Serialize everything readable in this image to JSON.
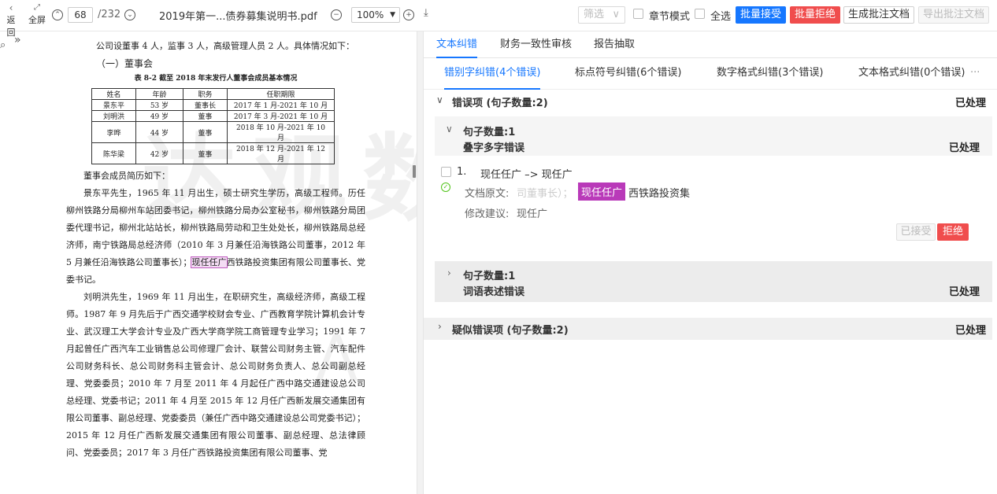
{
  "toolbar": {
    "back_label": "返回",
    "fullscreen_label": "全屏",
    "page_current": "68",
    "page_total": "/232",
    "file_name": "2019年第一...债券募集说明书.pdf",
    "zoom": "100%",
    "filter_placeholder": "筛选",
    "chapter_mode": "章节模式",
    "select_all": "全选",
    "batch_accept": "批量接受",
    "batch_reject": "批量拒绝",
    "gen_doc": "生成批注文档",
    "export_doc": "导出批注文档"
  },
  "document": {
    "line1": "公司设董事 4 人，监事 3 人，高级管理人员 2 人。具体情况如下：",
    "section": "（一）董事会",
    "table_title": "表 8-2  截至 2018 年末发行人董事会成员基本情况",
    "table_headers": [
      "姓名",
      "年龄",
      "职务",
      "任职期限"
    ],
    "table_rows": [
      [
        "景东平",
        "53 岁",
        "董事长",
        "2017 年 1 月-2021 年 10 月"
      ],
      [
        "刘明洪",
        "49 岁",
        "董事",
        "2017 年 3 月-2021 年 10 月"
      ],
      [
        "李晔",
        "44 岁",
        "董事",
        "2018 年 10 月-2021 年 10 月"
      ],
      [
        "陈华梁",
        "42 岁",
        "董事",
        "2018 年 12 月-2021 年 12 月"
      ]
    ],
    "intro": "董事会成员简历如下：",
    "para1_a": "景东平先生，1965 年 11 月出生，硕士研究生学历，高级工程师。历任柳州铁路分局柳州车站团委书记，柳州铁路分局办公室秘书，柳州铁路分局团委代理书记，柳州北站站长，柳州铁路局劳动和卫生处处长，柳州铁路局总经济师，南宁铁路局总经济师（2010 年 3 月兼任沿海铁路公司董事，2012 年 5 月兼任沿海铁路公司董事长）；",
    "para1_hl": "现任任广",
    "para1_b": "西铁路投资集团有限公司董事长、党委书记。",
    "para2": "刘明洪先生，1969 年 11 月出生，在职研究生，高级经济师，高级工程师。1987 年 9 月先后于广西交通学校财会专业、广西教育学院计算机会计专业、武汉理工大学会计专业及广西大学商学院工商管理专业学习；1991 年 7 月起曾任广西汽车工业销售总公司修理厂会计、联营公司财务主管、汽车配件公司财务科长、总公司财务科主管会计、总公司财务负责人、总公司副总经理、党委委员；2010 年 7 月至 2011 年 4 月起任广西中路交通建设总公司总经理、党委书记；2011 年 4 月至 2015 年 12 月任广西新发展交通集团有限公司董事、副总经理、党委委员（兼任广西中路交通建设总公司党委书记）；2015 年 12 月任广西新发展交通集团有限公司董事、副总经理、总法律顾问、党委委员；2017 年 3 月任广西铁路投资集团有限公司董事、党"
  },
  "panel": {
    "tabs": [
      "文本纠错",
      "财务一致性审核",
      "报告抽取"
    ],
    "subtabs": [
      "错别字纠错(4个错误)",
      "标点符号纠错(6个错误)",
      "数字格式纠错(3个错误)",
      "文本格式纠错(0个错误)"
    ],
    "more": "···",
    "errors_header": "错误项 (句子数量:2)",
    "errors_status": "已处理",
    "group1_count": "句子数量:1",
    "group1_type": "叠字多字错误",
    "group1_status": "已处理",
    "item_index": "1.",
    "item_change": "现任任广 –> 现任广",
    "orig_label": "文档原文:",
    "orig_before": "司董事长）；",
    "orig_hl": "现任任广",
    "orig_after": "西铁路投资集",
    "suggest_label": "修改建议:",
    "suggest_value": "现任广",
    "accepted": "已接受",
    "reject": "拒绝",
    "group2_count": "句子数量:1",
    "group2_type": "词语表述错误",
    "group2_status": "已处理",
    "suspect_header": "疑似错误项 (句子数量:2)",
    "suspect_status": "已处理"
  },
  "colors": {
    "accent": "#1677ff",
    "danger": "#f04d4d",
    "highlight": "#b93ab9"
  }
}
